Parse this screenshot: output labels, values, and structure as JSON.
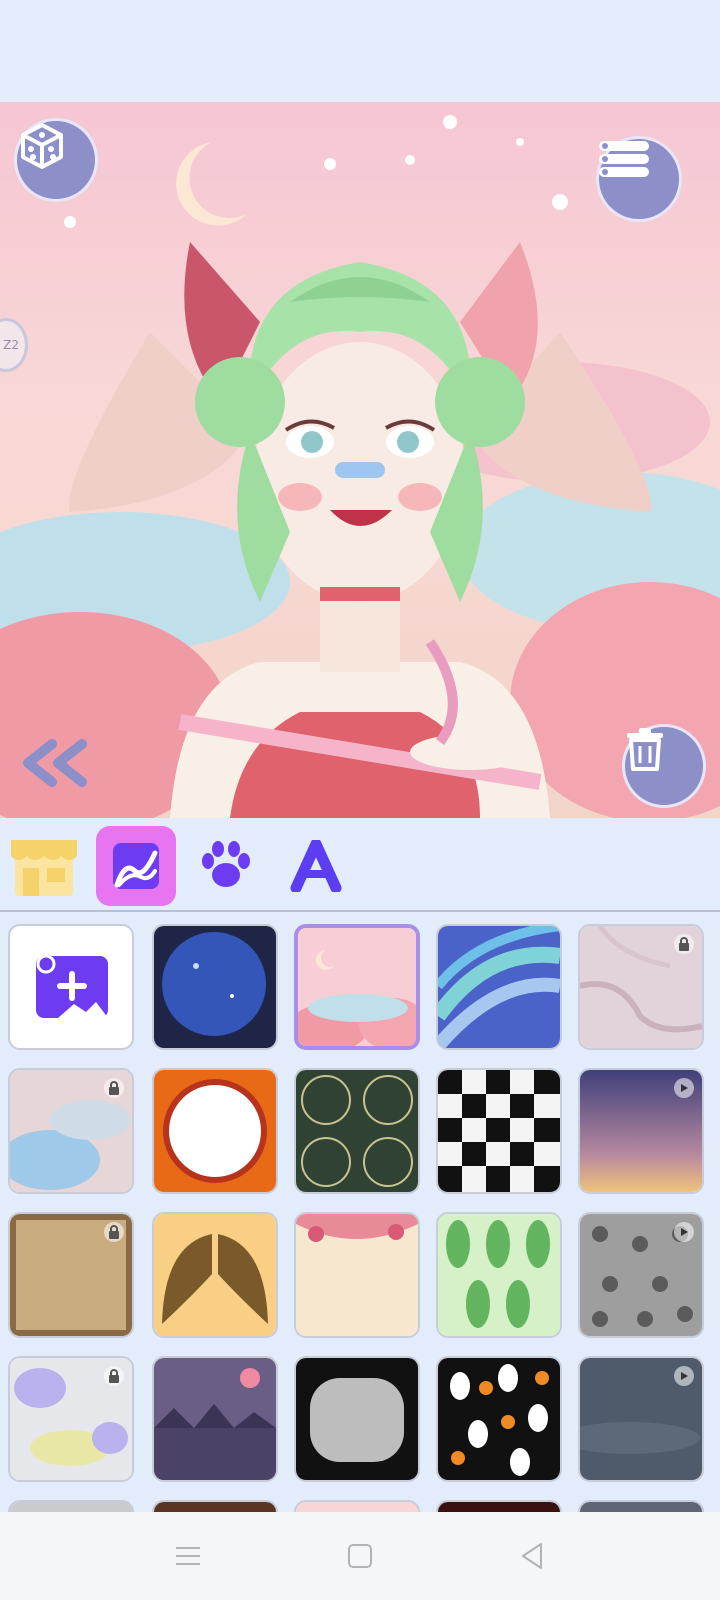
{
  "app": {
    "screen": "avatar-background-picker"
  },
  "side_tab": {
    "label": "Z2"
  },
  "colors": {
    "accent": "#8c8fc8",
    "tab_active": "#e774f1",
    "shop": "#f5d36a",
    "paw": "#6d3cf0",
    "text_icon": "#5b3df2",
    "add_tile": "#6d3cf0"
  },
  "toolbar": {
    "dice": "dice-icon",
    "menu": "list-icon",
    "back": "double-chevron-left-icon",
    "delete": "trash-icon"
  },
  "tabs": [
    {
      "icon": "shop-icon",
      "active": false
    },
    {
      "icon": "background-icon",
      "active": true
    },
    {
      "icon": "paw-icon",
      "active": false
    },
    {
      "icon": "text-A-icon",
      "active": false
    }
  ],
  "backgrounds": [
    {
      "name": "add-photo",
      "badge": ""
    },
    {
      "name": "galaxy-moon",
      "badge": ""
    },
    {
      "name": "pastel-sky-clouds",
      "badge": "",
      "selected": true
    },
    {
      "name": "blue-wave-lines",
      "badge": ""
    },
    {
      "name": "pink-marble",
      "badge": "lock"
    },
    {
      "name": "watercolor-blue",
      "badge": "lock"
    },
    {
      "name": "orange-mandala-circle",
      "badge": ""
    },
    {
      "name": "green-tile-pattern",
      "badge": ""
    },
    {
      "name": "checkerboard",
      "badge": ""
    },
    {
      "name": "sunset-sky",
      "badge": "video"
    },
    {
      "name": "old-parchment",
      "badge": "lock"
    },
    {
      "name": "golden-wings",
      "badge": ""
    },
    {
      "name": "floral-frame",
      "badge": ""
    },
    {
      "name": "green-leaves",
      "badge": ""
    },
    {
      "name": "grey-skulls",
      "badge": "video"
    },
    {
      "name": "paint-splash",
      "badge": "lock"
    },
    {
      "name": "purple-lake",
      "badge": ""
    },
    {
      "name": "halloween-frame",
      "badge": ""
    },
    {
      "name": "ghosts-pumpkins",
      "badge": ""
    },
    {
      "name": "night-sky-moon",
      "badge": "video"
    },
    {
      "name": "row5-1",
      "badge": ""
    },
    {
      "name": "row5-2",
      "badge": ""
    },
    {
      "name": "row5-3",
      "badge": ""
    },
    {
      "name": "row5-4",
      "badge": ""
    },
    {
      "name": "row5-5",
      "badge": ""
    }
  ],
  "navbar": {
    "menu": "menu-icon",
    "home": "square-icon",
    "back": "triangle-back-icon"
  }
}
